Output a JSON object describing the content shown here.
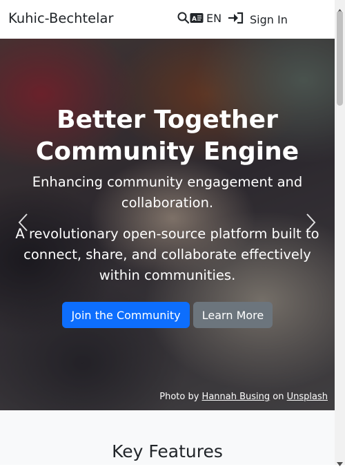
{
  "nav": {
    "brand": "Kuhic-Bechtelar",
    "language": "EN",
    "sign_in": "Sign In"
  },
  "hero": {
    "title_line1": "Better Together",
    "title_line2": "Community Engine",
    "subtitle": "Enhancing community engagement and collaboration.",
    "description": "A revolutionary open-source platform built to connect, share, and collaborate effectively within communities.",
    "primary_button": "Join the Community",
    "secondary_button": "Learn More",
    "credit": {
      "prefix": "Photo by",
      "author": "Hannah Busing",
      "middle": "on",
      "source": "Unsplash"
    }
  },
  "features": {
    "title": "Key Features"
  },
  "colors": {
    "primary": "#0d6efd",
    "secondary": "#6c757d",
    "features_bg": "#f8f9fa"
  },
  "icons": [
    "search-icon",
    "language-icon",
    "sign-in-icon",
    "chevron-left-icon",
    "chevron-right-icon"
  ]
}
